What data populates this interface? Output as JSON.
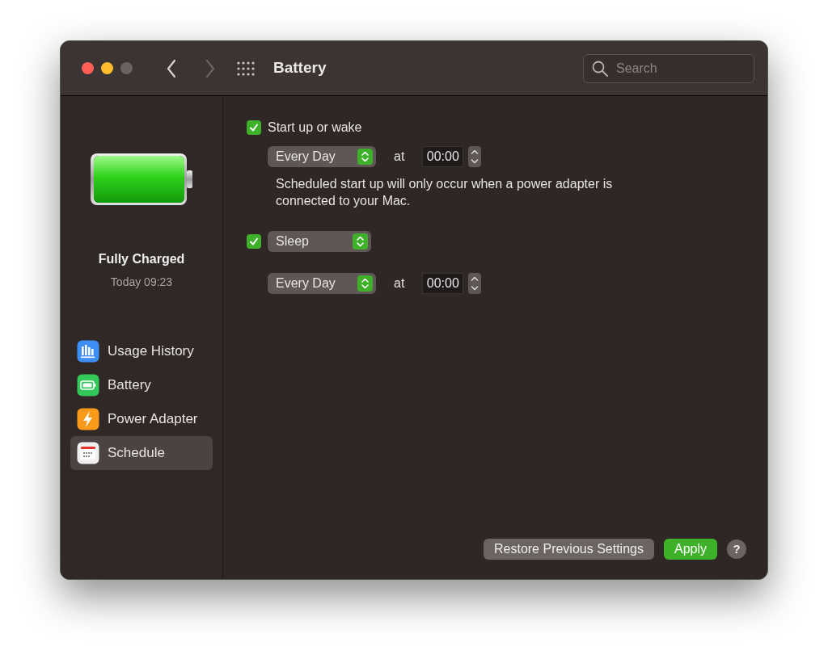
{
  "window": {
    "title": "Battery"
  },
  "nav": {
    "back_enabled": true,
    "forward_enabled": false
  },
  "search": {
    "placeholder": "Search"
  },
  "battery": {
    "level": 1,
    "status": "Fully Charged",
    "time": "Today 09:23"
  },
  "sidebar": {
    "items": [
      {
        "kind": "chart",
        "label": "Usage History",
        "selected": false
      },
      {
        "kind": "battery",
        "label": "Battery",
        "selected": false
      },
      {
        "kind": "bolt",
        "label": "Power Adapter",
        "selected": false
      },
      {
        "kind": "calendar",
        "label": "Schedule",
        "selected": true
      }
    ]
  },
  "schedule": [
    {
      "kind": "label",
      "checked": true,
      "label": "Start up or wake",
      "repeat": "Every Day",
      "at": "at",
      "time": "00:00",
      "note": "Scheduled start up will only occur when a power adapter is connected to your Mac."
    },
    {
      "kind": "menu",
      "checked": true,
      "action": "Sleep",
      "repeat": "Every Day",
      "at": "at",
      "time": "00:00"
    }
  ],
  "buttons": [
    {
      "kind": "secondary",
      "label": "Restore Previous Settings"
    },
    {
      "kind": "primary",
      "label": "Apply"
    },
    {
      "kind": "help",
      "label": "?"
    }
  ]
}
